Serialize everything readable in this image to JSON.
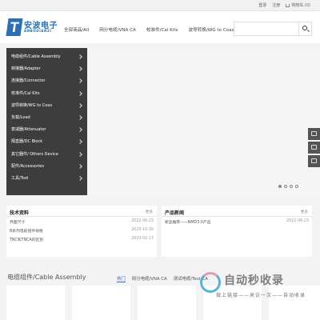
{
  "topbar": {
    "login": "登录",
    "register": "注册",
    "cart": "购物车 (0)"
  },
  "logo": {
    "mark": "T",
    "cn": "安波电子",
    "en": "ANBODIANZI"
  },
  "nav": [
    "全部商品/All",
    "网分电缆/VNA CA",
    "校准件/Cal Kits",
    "波导转换/WG to Coax"
  ],
  "search": {
    "placeholder": ""
  },
  "sidebar": [
    "电缆组件/Cable Assembly",
    "转接器/Adapter",
    "连接器/Connector",
    "校准件/Cal Kits",
    "波导转换/WG to Coax",
    "负载/Load",
    "衰减器/Attenuator",
    "隔直器/DC Block",
    "其它器件/ Others Device",
    "配件/Accessories",
    "工具/Tool"
  ],
  "tech": {
    "title": "技术资料",
    "more": "更多",
    "rows": [
      {
        "t": "界面尺寸",
        "d": "2022-06-23"
      },
      {
        "t": "B系列电缆组件规格",
        "d": "2023-10-30"
      },
      {
        "t": "TNC和TNCA的区别",
        "d": "2023-02-17"
      }
    ]
  },
  "news": {
    "title": "产品新闻",
    "more": "更多",
    "rows": [
      {
        "t": "新品推荐——NMD3.0产品",
        "d": "2022-06-23"
      }
    ]
  },
  "section": {
    "title": "电缆组件/Cable Assembly",
    "tabs": [
      "热门",
      "网分电缆/VNA CA",
      "测试电缆/Test CA"
    ]
  },
  "watermark": {
    "text": "自动秒收录",
    "sub": "做上链接——来访一次——自动收录"
  },
  "colors": {
    "accent": "#2a70b8",
    "sidebar_bg": "#3d3d3d"
  }
}
